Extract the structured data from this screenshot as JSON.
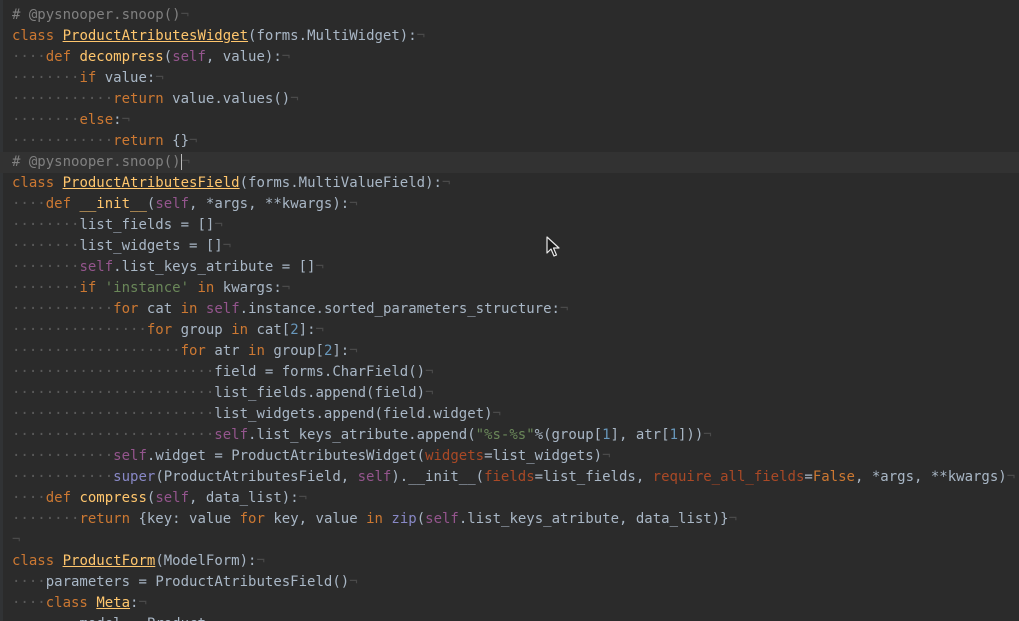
{
  "lines": [
    "# @pysnooper.snoop()",
    "class ProductAtributesWidget(forms.MultiWidget):",
    "    def decompress(self, value):",
    "        if value:",
    "            return value.values()",
    "        else:",
    "            return {}",
    "# @pysnooper.snoop()",
    "class ProductAtributesField(forms.MultiValueField):",
    "    def __init__(self, *args, **kwargs):",
    "        list_fields = []",
    "        list_widgets = []",
    "        self.list_keys_atribute = []",
    "        if 'instance' in kwargs:",
    "            for cat in self.instance.sorted_parameters_structure:",
    "                for group in cat[2]:",
    "                    for atr in group[2]:",
    "                        field = forms.CharField()",
    "                        list_fields.append(field)",
    "                        list_widgets.append(field.widget)",
    "                        self.list_keys_atribute.append(\"%s-%s\"%(group[1], atr[1]))",
    "            self.widget = ProductAtributesWidget(widgets=list_widgets)",
    "            super(ProductAtributesField, self).__init__(fields=list_fields, require_all_fields=False, *args, **kwargs)",
    "    def compress(self, data_list):",
    "        return {key: value for key, value in zip(self.list_keys_atribute, data_list)}",
    "",
    "class ProductForm(ModelForm):",
    "    parameters = ProductAtributesField()",
    "    class Meta:",
    "        model = Product"
  ],
  "current_line_index": 7,
  "colors": {
    "background": "#2b2b2b",
    "text": "#a9b7c6",
    "keyword": "#cc7832",
    "function": "#ffc66d",
    "self": "#94558d",
    "comment": "#808080",
    "string": "#6a8759",
    "number": "#6897bb",
    "kwarg": "#aa4926",
    "builtin": "#8888c6"
  },
  "icons": {
    "pointer": "mouse-pointer-icon"
  }
}
